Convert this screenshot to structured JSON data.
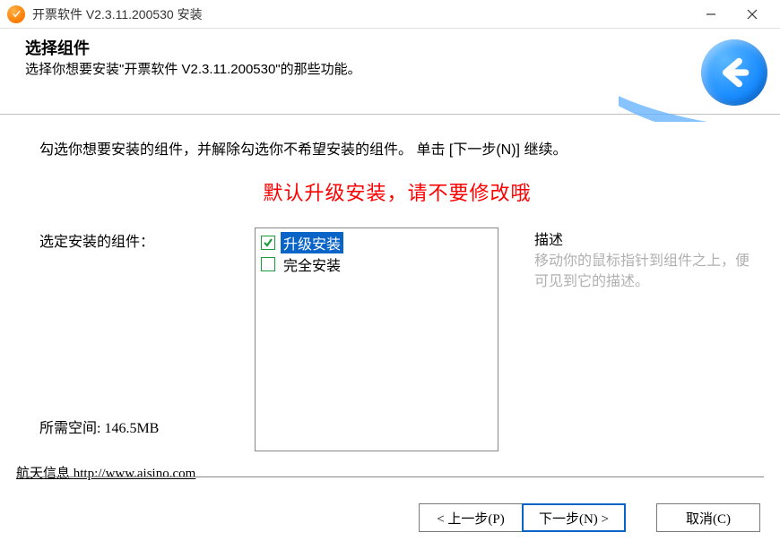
{
  "window": {
    "title": "开票软件 V2.3.11.200530 安装"
  },
  "header": {
    "title": "选择组件",
    "desc": "选择你想要安装\"开票软件 V2.3.11.200530\"的那些功能。"
  },
  "body": {
    "instruction": "勾选你想要安装的组件，并解除勾选你不希望安装的组件。 单击 [下一步(N)] 继续。",
    "warning": "默认升级安装，请不要修改哦",
    "components_label": "选定安装的组件：",
    "components": [
      {
        "label": "升级安装",
        "checked": true,
        "selected": true
      },
      {
        "label": "完全安装",
        "checked": false,
        "selected": false
      }
    ],
    "desc_title": "描述",
    "desc_text": "移动你的鼠标指针到组件之上，便可见到它的描述。",
    "space": "所需空间: 146.5MB"
  },
  "vendor": {
    "name": "航天信息",
    "url_label": "http://www.aisino.com"
  },
  "footer": {
    "back": "< 上一步(P)",
    "next": "下一步(N) >",
    "cancel": "取消(C)"
  }
}
